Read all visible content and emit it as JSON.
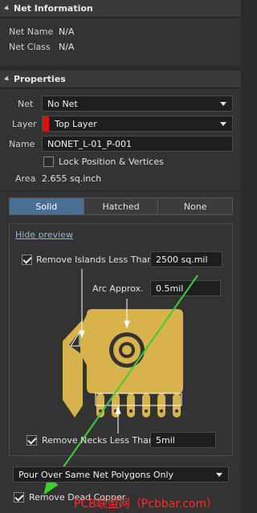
{
  "net_info": {
    "header": "Net Information",
    "net_name_label": "Net Name",
    "net_name_value": "N/A",
    "net_class_label": "Net Class",
    "net_class_value": "N/A"
  },
  "properties": {
    "header": "Properties",
    "net_label": "Net",
    "net_value": "No Net",
    "layer_label": "Layer",
    "layer_value": "Top Layer",
    "layer_color": "#e01010",
    "name_label": "Name",
    "name_value": "NONET_L-01_P-001",
    "lock_label": "Lock Position & Vertices",
    "area_label": "Area",
    "area_value": "2.655 sq.inch"
  },
  "fill_mode": {
    "options": [
      "Solid",
      "Hatched",
      "None"
    ],
    "selected": "Solid"
  },
  "preview": {
    "hide_link": "Hide preview",
    "remove_islands_label": "Remove Islands Less Than",
    "remove_islands_value": "2500 sq.mil",
    "arc_approx_label": "Arc Approx.",
    "arc_approx_value": "0.5mil",
    "remove_necks_label": "Remove Necks Less Than",
    "remove_necks_value": "5mil",
    "copper_color": "#d8b24a"
  },
  "pour_over": {
    "value": "Pour Over Same Net Polygons Only"
  },
  "remove_dead_copper": {
    "label": "Remove Dead Copper"
  },
  "watermark": {
    "text": "PCB联盟网（Pcbbar.com）"
  }
}
